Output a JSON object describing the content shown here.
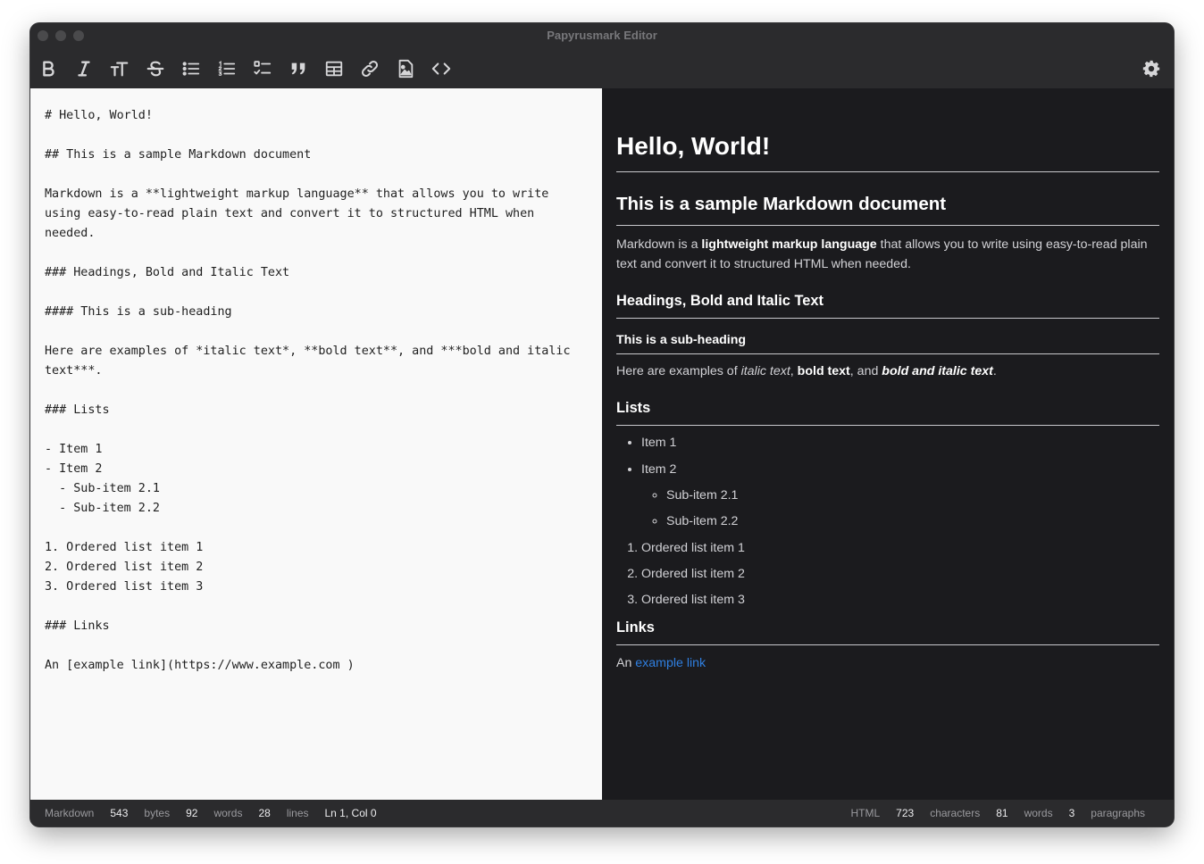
{
  "window": {
    "title": "Papyrusmark Editor"
  },
  "toolbar": {
    "buttons": [
      {
        "name": "bold-button",
        "icon": "bold-icon"
      },
      {
        "name": "italic-button",
        "icon": "italic-icon"
      },
      {
        "name": "heading-button",
        "icon": "text-size-icon"
      },
      {
        "name": "strikethrough-button",
        "icon": "strikethrough-icon"
      },
      {
        "name": "bullet-list-button",
        "icon": "bullet-list-icon"
      },
      {
        "name": "numbered-list-button",
        "icon": "numbered-list-icon"
      },
      {
        "name": "task-list-button",
        "icon": "checklist-icon"
      },
      {
        "name": "quote-button",
        "icon": "quote-icon"
      },
      {
        "name": "table-button",
        "icon": "table-icon"
      },
      {
        "name": "link-button",
        "icon": "link-icon"
      },
      {
        "name": "image-button",
        "icon": "image-file-icon"
      },
      {
        "name": "code-button",
        "icon": "code-icon"
      }
    ],
    "settings_icon": "gear-icon"
  },
  "editor": {
    "source": "# Hello, World!\n\n## This is a sample Markdown document\n\nMarkdown is a **lightweight markup language** that allows you to write using easy-to-read plain text and convert it to structured HTML when needed.\n\n### Headings, Bold and Italic Text\n\n#### This is a sub-heading\n\nHere are examples of *italic text*, **bold text**, and ***bold and italic text***.\n\n### Lists\n\n- Item 1\n- Item 2\n  - Sub-item 2.1\n  - Sub-item 2.2\n\n1. Ordered list item 1\n2. Ordered list item 2\n3. Ordered list item 3\n\n### Links\n\nAn [example link](https://www.example.com )"
  },
  "preview": {
    "h1": "Hello, World!",
    "h2": "This is a sample Markdown document",
    "intro": {
      "before": "Markdown is a ",
      "bold": "lightweight markup language",
      "after": " that allows you to write using easy-to-read plain text and convert it to structured HTML when needed."
    },
    "h3_headings": "Headings, Bold and Italic Text",
    "h4_sub": "This is a sub-heading",
    "emphasis": {
      "before": "Here are examples of ",
      "italic": "italic text",
      "sep1": ", ",
      "bold": "bold text",
      "sep2": ", and ",
      "bold_italic": "bold and italic text",
      "end": "."
    },
    "h3_lists": "Lists",
    "bullets": [
      "Item 1",
      "Item 2"
    ],
    "sub_bullets": [
      "Sub-item 2.1",
      "Sub-item 2.2"
    ],
    "ordered": [
      "Ordered list item 1",
      "Ordered list item 2",
      "Ordered list item 3"
    ],
    "h3_links": "Links",
    "link_para": {
      "before": "An ",
      "link_text": "example link"
    }
  },
  "status": {
    "left": {
      "mode": "Markdown",
      "bytes_value": "543",
      "bytes_label": "bytes",
      "words_value": "92",
      "words_label": "words",
      "lines_value": "28",
      "lines_label": "lines",
      "cursor": "Ln 1, Col 0"
    },
    "right": {
      "mode": "HTML",
      "characters_value": "723",
      "characters_label": "characters",
      "words_value": "81",
      "words_label": "words",
      "paragraphs_value": "3",
      "paragraphs_label": "paragraphs"
    }
  },
  "colors": {
    "chrome": "#2b2b2d",
    "preview_bg": "#1b1b1e",
    "editor_bg": "#f9f9f9",
    "link": "#2f7fe0"
  }
}
